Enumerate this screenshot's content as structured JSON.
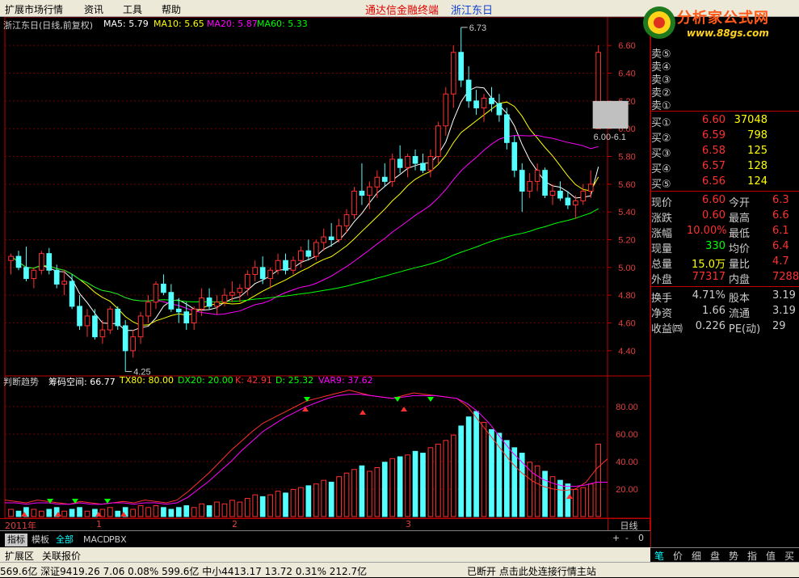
{
  "menu": {
    "items": [
      "扩展市场行情",
      "资讯",
      "工具",
      "帮助"
    ],
    "title": "通达信金融终端",
    "stock": "浙江东日"
  },
  "logo": {
    "text": "分析家公式网",
    "url": "www.88gs.com"
  },
  "chart": {
    "header": {
      "name": "浙江东日(日线,前复权)"
    },
    "ma_labels": [
      {
        "text": "MA5: 5.79",
        "color": "#ffffff"
      },
      {
        "text": "MA10: 5.65",
        "color": "#ffff00"
      },
      {
        "text": "MA20: 5.87",
        "color": "#ff00ff"
      },
      {
        "text": "MA60: 5.33",
        "color": "#00ff00"
      }
    ],
    "high_label": "6.73",
    "low_label": "4.25",
    "range_label": "6.00-6.1",
    "price_ticks": [
      "6.60",
      "6.40",
      "6.20",
      "6.00",
      "5.80",
      "5.60",
      "5.40",
      "5.20",
      "5.00",
      "4.80",
      "4.60",
      "4.40"
    ],
    "indicator_ticks": [
      "80.00",
      "60.00",
      "40.00",
      "20.00"
    ],
    "indicator_labels": [
      {
        "text": "判断趋势",
        "color": "#cccccc"
      },
      {
        "text": "筹码空间: 66.77",
        "color": "#ffffff"
      },
      {
        "text": "TX80: 80.00",
        "color": "#ffff00"
      },
      {
        "text": "DX20: 20.00",
        "color": "#00ff00"
      },
      {
        "text": "K: 42.91",
        "color": "#ff3030"
      },
      {
        "text": "D: 25.32",
        "color": "#00ff00"
      },
      {
        "text": "VAR9: 37.62",
        "color": "#ff00ff"
      }
    ],
    "x_labels": [
      "2011年",
      "1",
      "2",
      "3"
    ],
    "period": "日线"
  },
  "chart_data": {
    "type": "candlestick",
    "title": "浙江东日(日线,前复权)",
    "ylim": [
      4.3,
      6.7
    ],
    "candles": [
      [
        5.05,
        5.1,
        4.95,
        5.08
      ],
      [
        5.08,
        5.12,
        4.98,
        5.0
      ],
      [
        5.0,
        5.15,
        4.9,
        4.92
      ],
      [
        4.92,
        5.0,
        4.85,
        4.98
      ],
      [
        4.98,
        5.12,
        4.95,
        5.1
      ],
      [
        5.1,
        5.14,
        4.95,
        4.98
      ],
      [
        4.98,
        5.02,
        4.85,
        4.88
      ],
      [
        4.88,
        4.98,
        4.8,
        4.9
      ],
      [
        4.9,
        4.95,
        4.7,
        4.72
      ],
      [
        4.72,
        4.8,
        4.55,
        4.58
      ],
      [
        4.58,
        4.7,
        4.5,
        4.65
      ],
      [
        4.65,
        4.7,
        4.48,
        4.5
      ],
      [
        4.5,
        4.62,
        4.45,
        4.55
      ],
      [
        4.55,
        4.72,
        4.52,
        4.7
      ],
      [
        4.7,
        4.72,
        4.55,
        4.58
      ],
      [
        4.58,
        4.62,
        4.25,
        4.4
      ],
      [
        4.4,
        4.55,
        4.35,
        4.5
      ],
      [
        4.5,
        4.68,
        4.45,
        4.65
      ],
      [
        4.65,
        4.8,
        4.6,
        4.75
      ],
      [
        4.75,
        4.9,
        4.7,
        4.88
      ],
      [
        4.88,
        4.95,
        4.8,
        4.82
      ],
      [
        4.82,
        4.88,
        4.68,
        4.7
      ],
      [
        4.7,
        4.78,
        4.6,
        4.68
      ],
      [
        4.68,
        4.75,
        4.55,
        4.6
      ],
      [
        4.6,
        4.72,
        4.55,
        4.7
      ],
      [
        4.7,
        4.85,
        4.65,
        4.78
      ],
      [
        4.78,
        4.85,
        4.7,
        4.72
      ],
      [
        4.72,
        4.8,
        4.66,
        4.75
      ],
      [
        4.75,
        4.85,
        4.72,
        4.8
      ],
      [
        4.8,
        4.9,
        4.75,
        4.82
      ],
      [
        4.82,
        4.88,
        4.75,
        4.85
      ],
      [
        4.85,
        4.98,
        4.8,
        4.95
      ],
      [
        4.95,
        5.05,
        4.9,
        5.0
      ],
      [
        5.0,
        5.08,
        4.88,
        4.92
      ],
      [
        4.92,
        5.0,
        4.85,
        4.98
      ],
      [
        4.98,
        5.1,
        4.95,
        5.05
      ],
      [
        5.05,
        5.1,
        4.95,
        4.98
      ],
      [
        4.98,
        5.08,
        4.95,
        5.05
      ],
      [
        5.05,
        5.15,
        5.0,
        5.12
      ],
      [
        5.12,
        5.2,
        5.05,
        5.08
      ],
      [
        5.08,
        5.2,
        5.05,
        5.18
      ],
      [
        5.18,
        5.28,
        5.12,
        5.22
      ],
      [
        5.22,
        5.32,
        5.15,
        5.2
      ],
      [
        5.2,
        5.35,
        5.18,
        5.3
      ],
      [
        5.3,
        5.42,
        5.25,
        5.38
      ],
      [
        5.38,
        5.58,
        5.35,
        5.55
      ],
      [
        5.55,
        5.75,
        5.45,
        5.52
      ],
      [
        5.52,
        5.62,
        5.42,
        5.58
      ],
      [
        5.58,
        5.7,
        5.5,
        5.65
      ],
      [
        5.65,
        5.75,
        5.58,
        5.62
      ],
      [
        5.62,
        5.82,
        5.58,
        5.78
      ],
      [
        5.78,
        5.88,
        5.68,
        5.72
      ],
      [
        5.72,
        5.82,
        5.65,
        5.8
      ],
      [
        5.8,
        5.85,
        5.7,
        5.75
      ],
      [
        5.75,
        5.82,
        5.68,
        5.7
      ],
      [
        5.7,
        5.85,
        5.65,
        5.8
      ],
      [
        5.8,
        6.05,
        5.75,
        6.02
      ],
      [
        6.02,
        6.3,
        5.95,
        6.25
      ],
      [
        6.25,
        6.6,
        6.15,
        6.55
      ],
      [
        6.55,
        6.73,
        6.3,
        6.35
      ],
      [
        6.35,
        6.45,
        6.15,
        6.2
      ],
      [
        6.2,
        6.28,
        6.1,
        6.15
      ],
      [
        6.15,
        6.25,
        6.05,
        6.22
      ],
      [
        6.22,
        6.3,
        6.12,
        6.18
      ],
      [
        6.18,
        6.25,
        6.05,
        6.1
      ],
      [
        6.1,
        6.15,
        5.85,
        5.9
      ],
      [
        5.9,
        5.95,
        5.65,
        5.7
      ],
      [
        5.7,
        5.75,
        5.4,
        5.55
      ],
      [
        5.55,
        5.68,
        5.5,
        5.62
      ],
      [
        5.62,
        5.75,
        5.55,
        5.7
      ],
      [
        5.7,
        5.72,
        5.5,
        5.52
      ],
      [
        5.52,
        5.6,
        5.45,
        5.55
      ],
      [
        5.55,
        5.62,
        5.48,
        5.5
      ],
      [
        5.5,
        5.55,
        5.42,
        5.45
      ],
      [
        5.45,
        5.52,
        5.35,
        5.48
      ],
      [
        5.48,
        5.6,
        5.45,
        5.55
      ],
      [
        5.55,
        5.7,
        5.5,
        5.6
      ],
      [
        6.0,
        6.6,
        6.0,
        6.55
      ]
    ],
    "volume": [
      4,
      3,
      5,
      4,
      3,
      4,
      5,
      3,
      4,
      5,
      3,
      4,
      4,
      5,
      3,
      5,
      4,
      6,
      5,
      6,
      5,
      4,
      5,
      6,
      5,
      7,
      6,
      8,
      7,
      9,
      8,
      10,
      12,
      11,
      12,
      14,
      13,
      15,
      16,
      17,
      18,
      20,
      19,
      22,
      24,
      26,
      28,
      25,
      27,
      30,
      32,
      33,
      34,
      36,
      35,
      38,
      40,
      42,
      45,
      50,
      55,
      58,
      52,
      48,
      46,
      42,
      38,
      35,
      30,
      28,
      25,
      22,
      20,
      18,
      15,
      16,
      18,
      40
    ],
    "k": [
      12,
      11,
      10,
      12,
      11,
      10,
      9,
      11,
      10,
      9,
      10,
      11,
      10,
      12,
      11,
      10,
      12,
      18,
      25,
      32,
      40,
      48,
      55,
      62,
      68,
      72,
      76,
      80,
      84,
      86,
      88,
      90,
      92,
      90,
      88,
      87,
      86,
      88,
      90,
      89,
      88,
      87,
      86,
      80,
      70,
      60,
      50,
      40,
      32,
      26,
      22,
      20,
      19,
      20,
      25,
      35,
      42
    ],
    "d": [
      10,
      10,
      9,
      10,
      10,
      9,
      9,
      10,
      9,
      9,
      10,
      10,
      9,
      10,
      10,
      9,
      10,
      14,
      20,
      26,
      33,
      40,
      48,
      55,
      62,
      67,
      72,
      76,
      80,
      83,
      86,
      88,
      89,
      89,
      88,
      87,
      86,
      87,
      88,
      88,
      88,
      87,
      86,
      82,
      76,
      68,
      58,
      48,
      40,
      32,
      27,
      24,
      22,
      22,
      23,
      25,
      25
    ]
  },
  "quote": {
    "sell": [
      {
        "label": "卖⑤"
      },
      {
        "label": "卖④"
      },
      {
        "label": "卖③"
      },
      {
        "label": "卖②"
      },
      {
        "label": "卖①"
      }
    ],
    "buy": [
      {
        "label": "买①",
        "price": "6.60",
        "vol": "37048"
      },
      {
        "label": "买②",
        "price": "6.59",
        "vol": "798"
      },
      {
        "label": "买③",
        "price": "6.58",
        "vol": "125"
      },
      {
        "label": "买④",
        "price": "6.57",
        "vol": "128"
      },
      {
        "label": "买⑤",
        "price": "6.56",
        "vol": "124"
      }
    ],
    "stats": [
      {
        "l1": "现价",
        "v1": "6.60",
        "c1": "#ff3030",
        "l2": "今开",
        "v2": "6.3"
      },
      {
        "l1": "涨跌",
        "v1": "0.60",
        "c1": "#ff3030",
        "l2": "最高",
        "v2": "6.6"
      },
      {
        "l1": "涨幅",
        "v1": "10.00%",
        "c1": "#ff3030",
        "l2": "最低",
        "v2": "6.1"
      },
      {
        "l1": "现量",
        "v1": "330",
        "c1": "#00ff00",
        "l2": "均价",
        "v2": "6.4"
      },
      {
        "l1": "总量",
        "v1": "15.0万",
        "c1": "#ffff00",
        "l2": "量比",
        "v2": "4.7"
      },
      {
        "l1": "外盘",
        "v1": "77317",
        "c1": "#ff3030",
        "l2": "内盘",
        "v2": "7288"
      }
    ],
    "fund": [
      {
        "l1": "换手",
        "v1": "4.71%",
        "l2": "股本",
        "v2": "3.19"
      },
      {
        "l1": "净资",
        "v1": "1.66",
        "l2": "流通",
        "v2": "3.19"
      },
      {
        "l1": "收益㈣",
        "v1": "0.226",
        "l2": "PE(动)",
        "v2": "29"
      }
    ]
  },
  "tabs": [
    "指标",
    "模板",
    "全部",
    "MACD",
    "PBX"
  ],
  "side_tabs": [
    "笔",
    "价",
    "细",
    "盘",
    "势",
    "指",
    "值",
    "买"
  ],
  "bottom": {
    "row1": [
      "扩展区",
      "关联报价"
    ],
    "status_left": "569.6亿 深证9419.26  7.06  0.08%  599.6亿 中小4413.17  13.72  0.31%  212.7亿",
    "status_right": "已断开  点击此处连接行情主站"
  },
  "colors": {
    "up": "#ff3030",
    "down": "#54ffff",
    "grid": "#c00000",
    "ma5": "#ffffff",
    "ma10": "#ffff00",
    "ma20": "#ff00ff",
    "ma60": "#00ff00"
  }
}
